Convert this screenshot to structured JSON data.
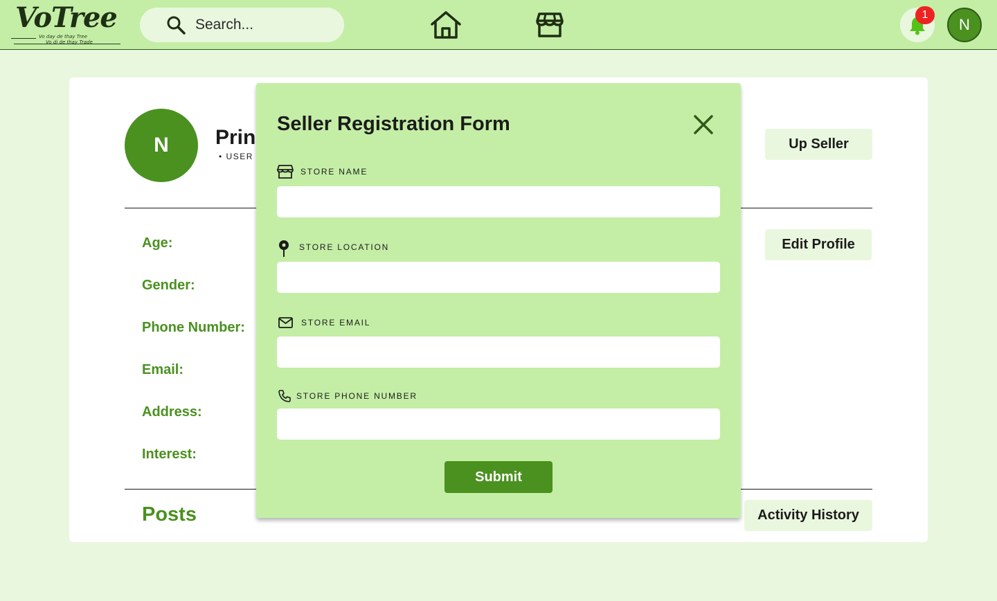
{
  "brand": {
    "name": "VoTree",
    "tagline_1": "Vo day de thay Tree",
    "tagline_2": "Vo di de thay Trade"
  },
  "search": {
    "placeholder": "Search..."
  },
  "nav": {
    "home_icon": "home-icon",
    "store_icon": "store-icon"
  },
  "notifications": {
    "count": "1"
  },
  "user": {
    "avatar_initial": "N"
  },
  "profile": {
    "avatar_initial": "N",
    "name": "Princ",
    "role": "• USER",
    "buttons": {
      "up_seller": "Up Seller",
      "edit_profile": "Edit Profile",
      "activity_history": "Activity History"
    },
    "fields": [
      "Age:",
      "Gender:",
      "Phone Number:",
      "Email:",
      "Address:",
      "Interest:"
    ],
    "posts_heading": "Posts"
  },
  "modal": {
    "title": "Seller Registration Form",
    "fields": [
      {
        "label": "STORE NAME",
        "icon": "store-icon",
        "value": ""
      },
      {
        "label": "STORE LOCATION",
        "icon": "location-pin-icon",
        "value": ""
      },
      {
        "label": "STORE EMAIL",
        "icon": "mail-icon",
        "value": ""
      },
      {
        "label": "STORE PHONE NUMBER",
        "icon": "phone-icon",
        "value": ""
      }
    ],
    "submit_label": "Submit"
  },
  "colors": {
    "topbar": "#c4eea6",
    "background": "#eaf7df",
    "accent": "#4a911f",
    "badge": "#ee2222"
  }
}
